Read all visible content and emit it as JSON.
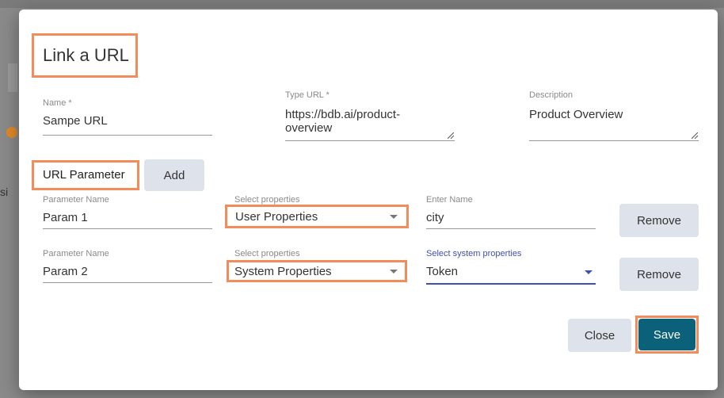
{
  "dialog": {
    "title": "Link a URL"
  },
  "fields": {
    "name": {
      "label": "Name *",
      "value": "Sampe URL"
    },
    "type_url": {
      "label": "Type URL *",
      "value": "https://bdb.ai/product-overview"
    },
    "description": {
      "label": "Description",
      "value": "Product Overview"
    }
  },
  "url_parameter": {
    "label": "URL Parameter",
    "add_label": "Add"
  },
  "params": [
    {
      "name_label": "Parameter Name",
      "name_value": "Param 1",
      "select_label": "Select properties",
      "select_value": "User Properties",
      "third_label": "Enter Name",
      "third_value": "city",
      "remove_label": "Remove"
    },
    {
      "name_label": "Parameter Name",
      "name_value": "Param 2",
      "select_label": "Select properties",
      "select_value": "System Properties",
      "third_label": "Select system properties",
      "third_value": "Token",
      "remove_label": "Remove"
    }
  ],
  "footer": {
    "close_label": "Close",
    "save_label": "Save"
  },
  "background": {
    "fragment_text": "si"
  },
  "colors": {
    "highlight": "#f28c5a",
    "primary": "#0b6179",
    "secondary_button": "#dee2ea",
    "focus_blue": "#3f51b5"
  }
}
